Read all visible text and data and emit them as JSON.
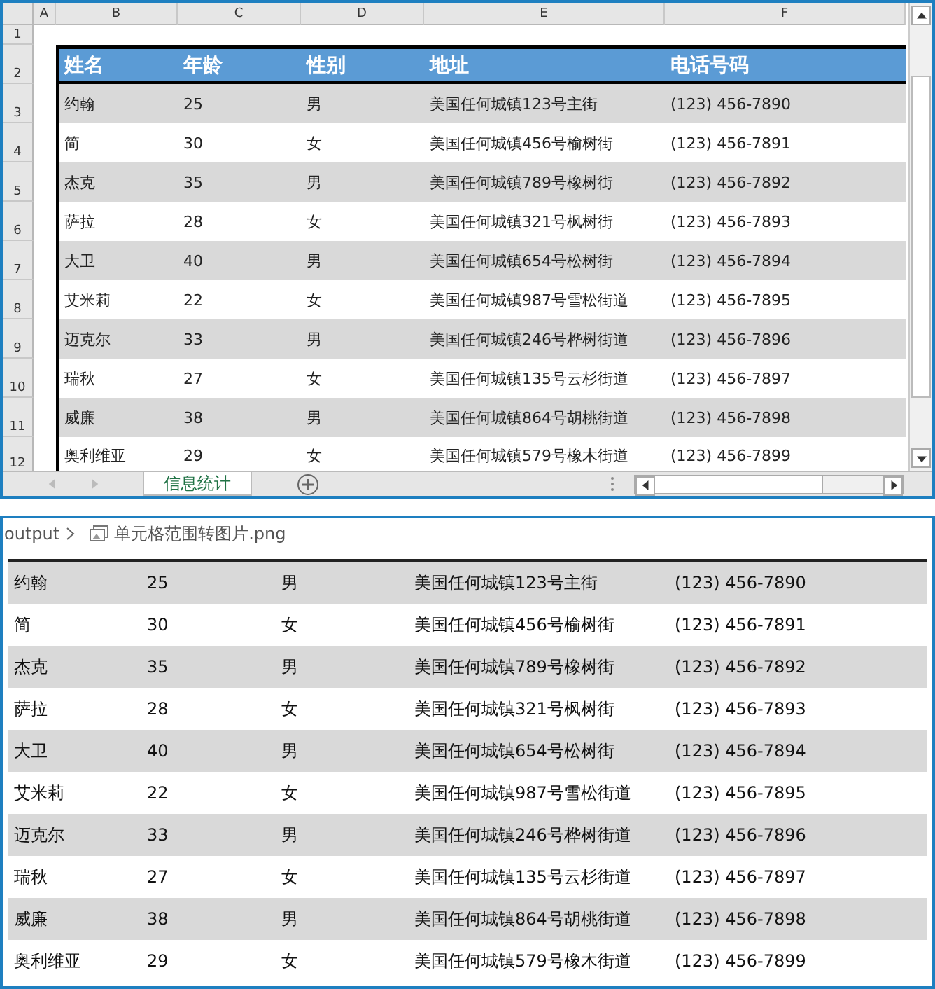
{
  "spreadsheet": {
    "column_headers": [
      "A",
      "B",
      "C",
      "D",
      "E",
      "F"
    ],
    "row_headers": [
      "1",
      "2",
      "3",
      "4",
      "5",
      "6",
      "7",
      "8",
      "9",
      "10",
      "11",
      "12"
    ],
    "table_header": [
      "姓名",
      "年龄",
      "性别",
      "地址",
      "电话号码"
    ],
    "rows": [
      {
        "cells": [
          "约翰",
          "25",
          "男",
          "美国任何城镇123号主街",
          "(123) 456-7890"
        ]
      },
      {
        "cells": [
          "简",
          "30",
          "女",
          "美国任何城镇456号榆树街",
          "(123) 456-7891"
        ]
      },
      {
        "cells": [
          "杰克",
          "35",
          "男",
          "美国任何城镇789号橡树街",
          "(123) 456-7892"
        ]
      },
      {
        "cells": [
          "萨拉",
          "28",
          "女",
          "美国任何城镇321号枫树街",
          "(123) 456-7893"
        ]
      },
      {
        "cells": [
          "大卫",
          "40",
          "男",
          "美国任何城镇654号松树街",
          "(123) 456-7894"
        ]
      },
      {
        "cells": [
          "艾米莉",
          "22",
          "女",
          "美国任何城镇987号雪松街道",
          "(123) 456-7895"
        ]
      },
      {
        "cells": [
          "迈克尔",
          "33",
          "男",
          "美国任何城镇246号桦树街道",
          "(123) 456-7896"
        ]
      },
      {
        "cells": [
          "瑞秋",
          "27",
          "女",
          "美国任何城镇135号云杉街道",
          "(123) 456-7897"
        ]
      },
      {
        "cells": [
          "威廉",
          "38",
          "男",
          "美国任何城镇864号胡桃街道",
          "(123) 456-7898"
        ]
      },
      {
        "cells": [
          "奥利维亚",
          "29",
          "女",
          "美国任何城镇579号橡木街道",
          "(123) 456-7899"
        ]
      }
    ],
    "sheet_tabs": [
      {
        "label": "信息统计",
        "selected": true
      }
    ]
  },
  "image_viewer": {
    "breadcrumb": [
      "output",
      "单元格范围转图片.png"
    ],
    "rows": [
      {
        "cells": [
          "约翰",
          "25",
          "男",
          "美国任何城镇123号主街",
          "(123) 456-7890"
        ]
      },
      {
        "cells": [
          "简",
          "30",
          "女",
          "美国任何城镇456号榆树街",
          "(123) 456-7891"
        ]
      },
      {
        "cells": [
          "杰克",
          "35",
          "男",
          "美国任何城镇789号橡树街",
          "(123) 456-7892"
        ]
      },
      {
        "cells": [
          "萨拉",
          "28",
          "女",
          "美国任何城镇321号枫树街",
          "(123) 456-7893"
        ]
      },
      {
        "cells": [
          "大卫",
          "40",
          "男",
          "美国任何城镇654号松树街",
          "(123) 456-7894"
        ]
      },
      {
        "cells": [
          "艾米莉",
          "22",
          "女",
          "美国任何城镇987号雪松街道",
          "(123) 456-7895"
        ]
      },
      {
        "cells": [
          "迈克尔",
          "33",
          "男",
          "美国任何城镇246号桦树街道",
          "(123) 456-7896"
        ]
      },
      {
        "cells": [
          "瑞秋",
          "27",
          "女",
          "美国任何城镇135号云杉街道",
          "(123) 456-7897"
        ]
      },
      {
        "cells": [
          "威廉",
          "38",
          "男",
          "美国任何城镇864号胡桃街道",
          "(123) 456-7898"
        ]
      },
      {
        "cells": [
          "奥利维亚",
          "29",
          "女",
          "美国任何城镇579号橡木街道",
          "(123) 456-7899"
        ]
      }
    ]
  }
}
